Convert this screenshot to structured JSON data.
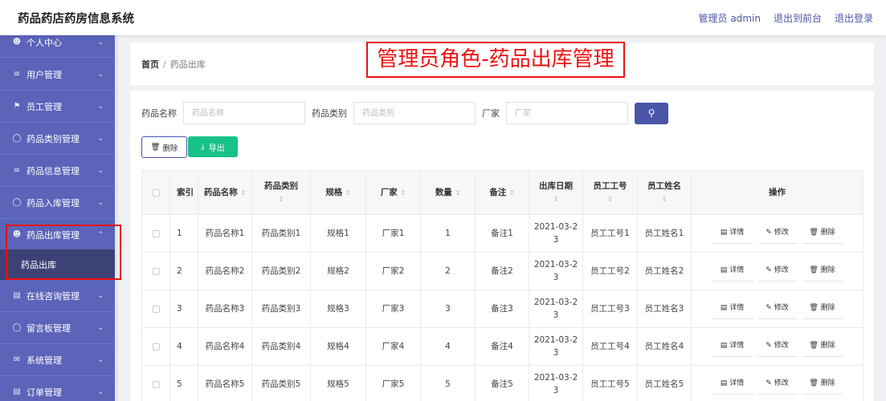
{
  "header": {
    "app_title": "药品药店药房信息系统",
    "links": [
      "管理员 admin",
      "退出到前台",
      "退出登录"
    ]
  },
  "sidebar": {
    "items": [
      {
        "label": "个人中心",
        "icon": "user-icon"
      },
      {
        "label": "用户管理",
        "icon": "sliders-icon"
      },
      {
        "label": "员工管理",
        "icon": "flag-icon"
      },
      {
        "label": "药品类别管理",
        "icon": "compass-icon"
      },
      {
        "label": "药品信息管理",
        "icon": "list-icon"
      },
      {
        "label": "药品入库管理",
        "icon": "compass-icon"
      },
      {
        "label": "药品出库管理",
        "icon": "user-icon",
        "expanded": true
      },
      {
        "label": "在线咨询管理",
        "icon": "clipboard-icon"
      },
      {
        "label": "留言板管理",
        "icon": "power-icon"
      },
      {
        "label": "系统管理",
        "icon": "mail-icon"
      },
      {
        "label": "订单管理",
        "icon": "document-icon"
      }
    ],
    "sub_item": "药品出库",
    "accent": "#5b64b9",
    "active_sub_bg": "#3c4276"
  },
  "breadcrumb": {
    "home": "首页",
    "separator": "/",
    "current": "药品出库"
  },
  "annotation": {
    "text": "管理员角色-药品出库管理",
    "color": "#e11111"
  },
  "search": {
    "fields": [
      {
        "label": "药品名称",
        "placeholder": "药品名称"
      },
      {
        "label": "药品类别",
        "placeholder": "药品类别"
      },
      {
        "label": "厂家",
        "placeholder": "厂家"
      }
    ],
    "search_icon": "search-icon"
  },
  "actions": {
    "delete_label": "删除",
    "export_label": "导出"
  },
  "table": {
    "headers": {
      "index": "索引",
      "name": "药品名称",
      "category": "药品类别",
      "spec": "规格",
      "maker": "厂家",
      "qty": "数量",
      "note": "备注",
      "date": "出库日期",
      "emp_no": "员工工号",
      "emp_name": "员工姓名",
      "ops": "操作"
    },
    "op_labels": {
      "detail": "详情",
      "edit": "修改",
      "delete": "删除"
    },
    "rows": [
      {
        "index": "1",
        "name": "药品名称1",
        "category": "药品类别1",
        "spec": "规格1",
        "maker": "厂家1",
        "qty": "1",
        "note": "备注1",
        "date1": "2021-03-2",
        "date2": "3",
        "emp_no": "员工工号1",
        "emp_name": "员工姓名1"
      },
      {
        "index": "2",
        "name": "药品名称2",
        "category": "药品类别2",
        "spec": "规格2",
        "maker": "厂家2",
        "qty": "2",
        "note": "备注2",
        "date1": "2021-03-2",
        "date2": "3",
        "emp_no": "员工工号2",
        "emp_name": "员工姓名2"
      },
      {
        "index": "3",
        "name": "药品名称3",
        "category": "药品类别3",
        "spec": "规格3",
        "maker": "厂家3",
        "qty": "3",
        "note": "备注3",
        "date1": "2021-03-2",
        "date2": "3",
        "emp_no": "员工工号3",
        "emp_name": "员工姓名3"
      },
      {
        "index": "4",
        "name": "药品名称4",
        "category": "药品类别4",
        "spec": "规格4",
        "maker": "厂家4",
        "qty": "4",
        "note": "备注4",
        "date1": "2021-03-2",
        "date2": "3",
        "emp_no": "员工工号4",
        "emp_name": "员工姓名4"
      },
      {
        "index": "5",
        "name": "药品名称5",
        "category": "药品类别5",
        "spec": "规格5",
        "maker": "厂家5",
        "qty": "5",
        "note": "备注5",
        "date1": "2021-03-2",
        "date2": "3",
        "emp_no": "员工工号5",
        "emp_name": "员工姓名5"
      }
    ]
  }
}
